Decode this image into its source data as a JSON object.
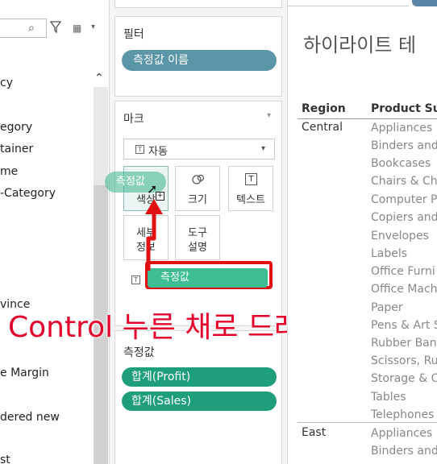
{
  "data_pane": {
    "icons": {
      "search": "search-icon",
      "filter": "filter-icon",
      "view": "view-list-icon"
    },
    "fields": [
      {
        "label": "cy"
      },
      {
        "label": "egory"
      },
      {
        "label": "tainer"
      },
      {
        "label": "me"
      },
      {
        "label": "-Category"
      },
      {
        "label": "vince"
      },
      {
        "label": "e Margin"
      },
      {
        "label": "dered new"
      },
      {
        "label": "st"
      }
    ]
  },
  "filters": {
    "title": "필터",
    "pill": "측정값 이름"
  },
  "marks": {
    "title": "마크",
    "mark_type": "자동",
    "buttons": {
      "color": "색상",
      "size": "크기",
      "text": "텍스트",
      "detail_line1": "세부",
      "detail_line2": "정보",
      "tooltip_line1": "도구",
      "tooltip_line2": "설명"
    },
    "dragged_pill": "측정값",
    "dropped_pill": "측정값"
  },
  "measures": {
    "title": "측정값",
    "items": [
      "합계(Profit)",
      "합계(Sales)"
    ]
  },
  "annotation": {
    "text": "Control 누른 채로 드래그",
    "color": "#e4002b"
  },
  "view": {
    "title": "하이라이트 테",
    "columns": {
      "region": "Region",
      "subcategory": "Product Sul"
    },
    "rows": [
      {
        "region": "Central",
        "subcategories": [
          "Appliances",
          "Binders and",
          "Bookcases",
          "Chairs & Ch",
          "Computer P",
          "Copiers and",
          "Envelopes",
          "Labels",
          "Office Furni",
          "Office Mach",
          "Paper",
          "Pens & Art S",
          "Rubber Ban",
          "Scissors, Ru",
          "Storage & O",
          "Tables",
          "Telephones"
        ]
      },
      {
        "region": "East",
        "subcategories": [
          "Appliances",
          "Binders and"
        ]
      }
    ]
  },
  "colors": {
    "measure_pill": "#1f9e7c",
    "filter_pill": "#5b95a8",
    "annotation_red": "#e21111"
  }
}
